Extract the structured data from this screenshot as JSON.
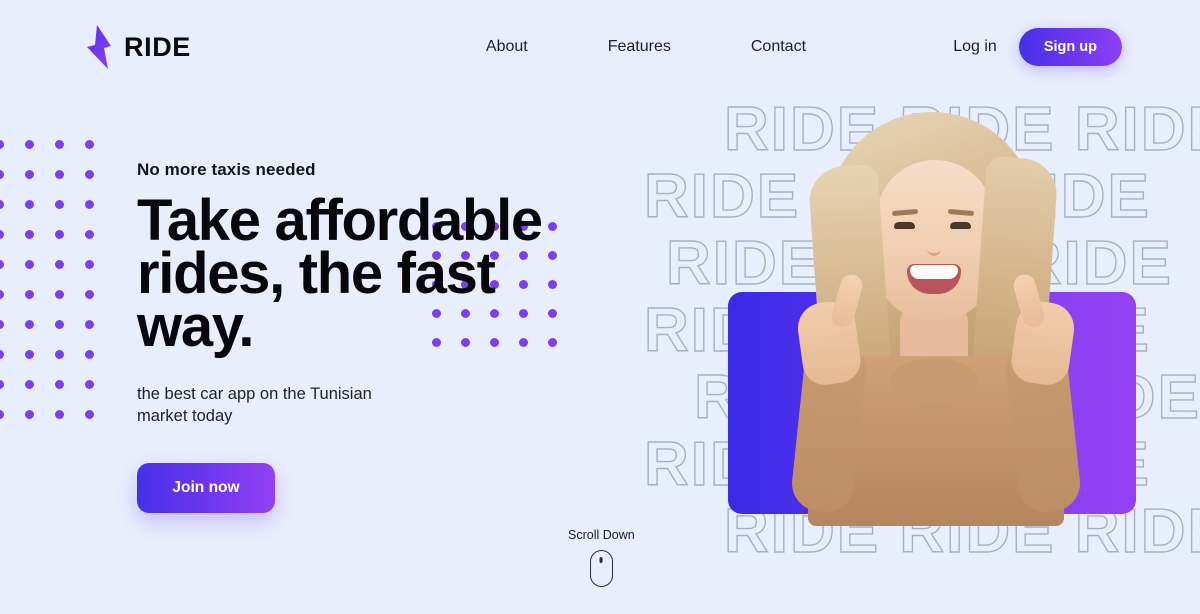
{
  "theme": {
    "background": "#e9eefc",
    "accent_purple": "#7b3ff0",
    "gradient_start": "#4630e9",
    "gradient_end": "#9341f3",
    "text_dark": "#08080c",
    "outline_text": "#9aa6bd"
  },
  "header": {
    "brand_name": "RIDE",
    "brand_mark_icon": "lightning-bolt-icon",
    "nav": [
      {
        "label": "About"
      },
      {
        "label": "Features"
      },
      {
        "label": "Contact"
      }
    ],
    "login_label": "Log in",
    "signup_label": "Sign up"
  },
  "hero": {
    "eyebrow": "No more taxis needed",
    "headline_line1": "Take affordable",
    "headline_line2": "rides, the fast",
    "headline_line3": "way.",
    "subcopy": "the best car app on the Tunisian market today",
    "cta_label": "Join now"
  },
  "scroll": {
    "label": "Scroll Down",
    "icon": "mouse-icon"
  },
  "background_art": {
    "repeating_word": "RIDE",
    "rows": [
      "RIDE RIDE RIDE",
      "RIDE RIDE RIDE",
      "RIDE RIDE RIDE",
      "RIDE RIDE RIDE",
      "RIDE RIDE RIDE",
      "RIDE RIDE RIDE",
      "RIDE RIDE RIDE"
    ]
  },
  "media": {
    "photo_alt": "smiling woman giving two thumbs up",
    "card_shape": "rounded-rectangle"
  },
  "decoration": {
    "left_dot_grid": {
      "columns": 4,
      "rows": 10,
      "spacing": 30,
      "dot_size": 9
    },
    "right_dot_grid": {
      "columns": 5,
      "rows": 5,
      "spacing": 29,
      "dot_size": 9
    }
  }
}
